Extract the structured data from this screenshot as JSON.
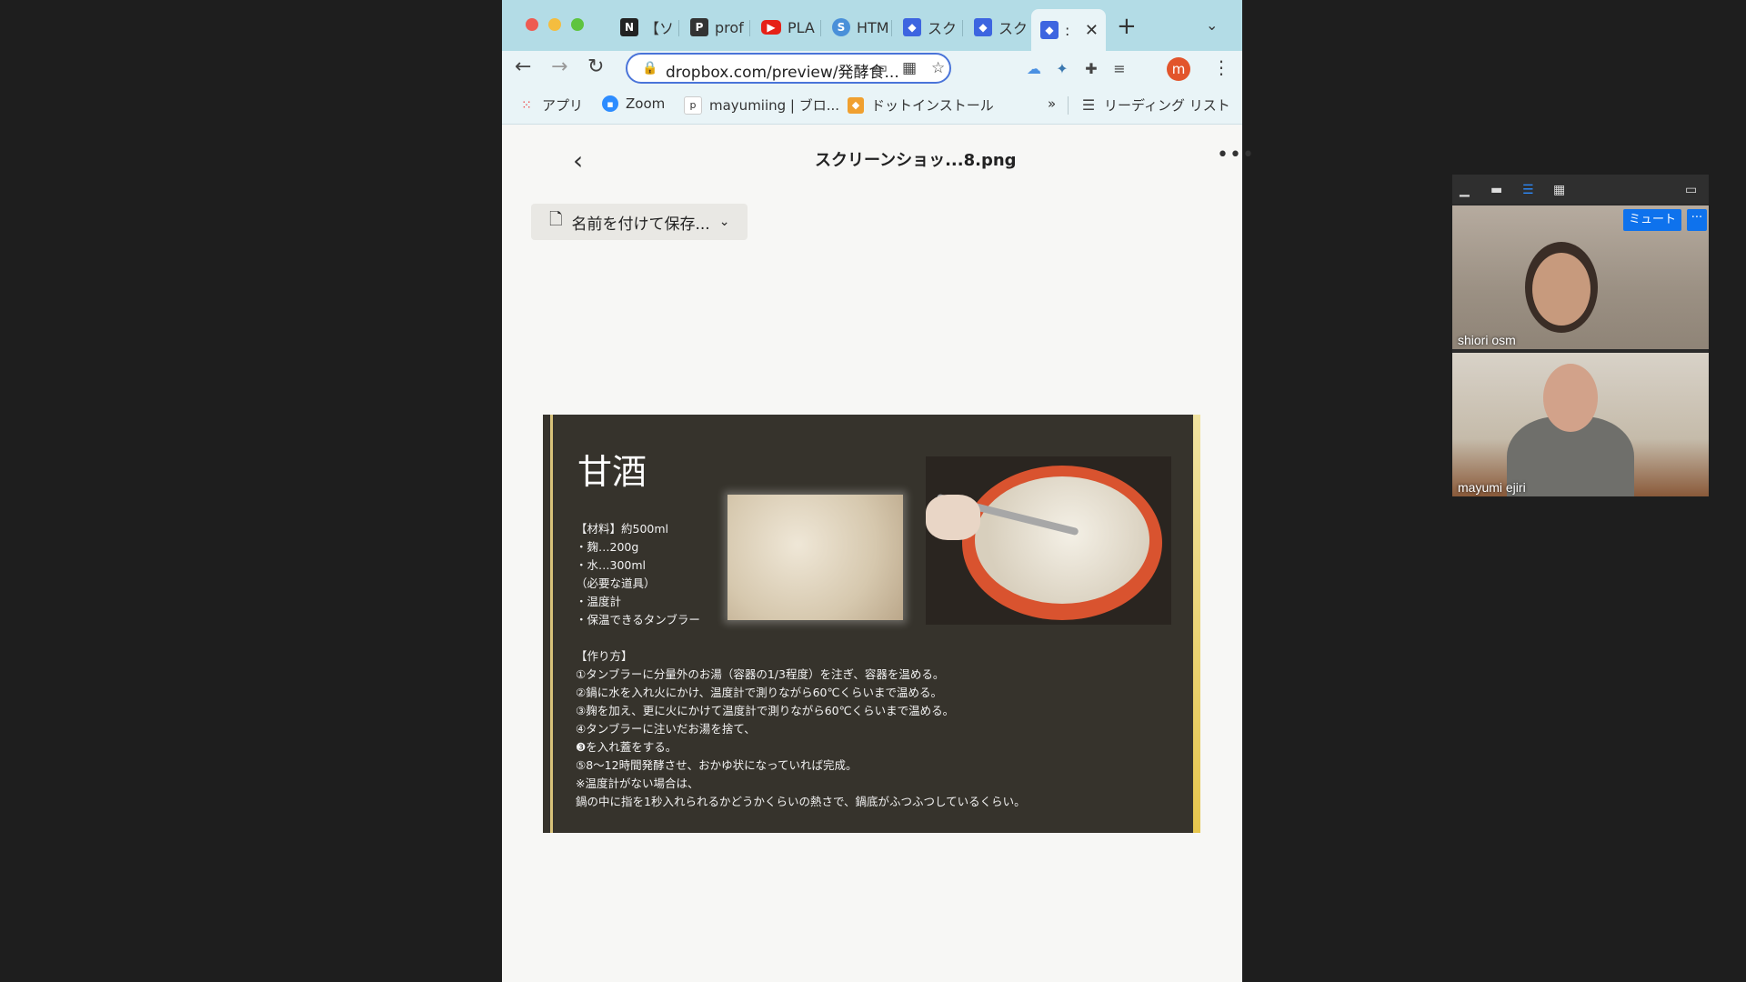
{
  "browser": {
    "tabs": [
      {
        "title": "【ソ",
        "favicon": "notion-icon"
      },
      {
        "title": "prof",
        "favicon": "p-icon"
      },
      {
        "title": "PLA",
        "favicon": "youtube-icon"
      },
      {
        "title": "HTM",
        "favicon": "html-icon"
      },
      {
        "title": "スク",
        "favicon": "dropbox-icon"
      },
      {
        "title": "スク",
        "favicon": "dropbox-icon"
      },
      {
        "title": ":",
        "favicon": "dropbox-icon",
        "active": true
      }
    ],
    "url": "dropbox.com/preview/発酵食...",
    "profile_initial": "m",
    "bookmarks": [
      {
        "label": "アプリ",
        "icon": "apps-grid-icon"
      },
      {
        "label": "Zoom",
        "icon": "zoom-icon"
      },
      {
        "label": "mayumiing | ブロ...",
        "icon": "note-icon"
      },
      {
        "label": "ドットインストール",
        "icon": "dotinstall-icon"
      }
    ],
    "overflow": "»",
    "reading_list": "リーディング リスト"
  },
  "dropbox": {
    "file_title": "スクリーンショッ...8.png",
    "save_as_label": "名前を付けて保存..."
  },
  "slide": {
    "title": "甘酒",
    "ingredients_header": "【材料】約500ml",
    "ingredients": [
      "・麹…200g",
      "・水…300ml",
      "（必要な道具）",
      "・温度計",
      "・保温できるタンブラー"
    ],
    "method_header": "【作り方】",
    "steps": [
      "①タンブラーに分量外のお湯（容器の1/3程度）を注ぎ、容器を温める。",
      "②鍋に水を入れ火にかけ、温度計で測りながら60℃くらいまで温める。",
      "③麹を加え、更に火にかけて温度計で測りながら60℃くらいまで温める。",
      "④タンブラーに注いだお湯を捨て、",
      "❸を入れ蓋をする。",
      "⑤8〜12時間発酵させ、おかゆ状になっていれば完成。",
      "※温度計がない場合は、",
      "鍋の中に指を1秒入れられるかどうかくらいの熱さで、鍋底がふつふつしているくらい。"
    ]
  },
  "zoom": {
    "participants": [
      {
        "name": "shiori osm"
      },
      {
        "name": "mayumi ejiri"
      }
    ],
    "mute_label": "ミュート",
    "more_label": "···"
  }
}
